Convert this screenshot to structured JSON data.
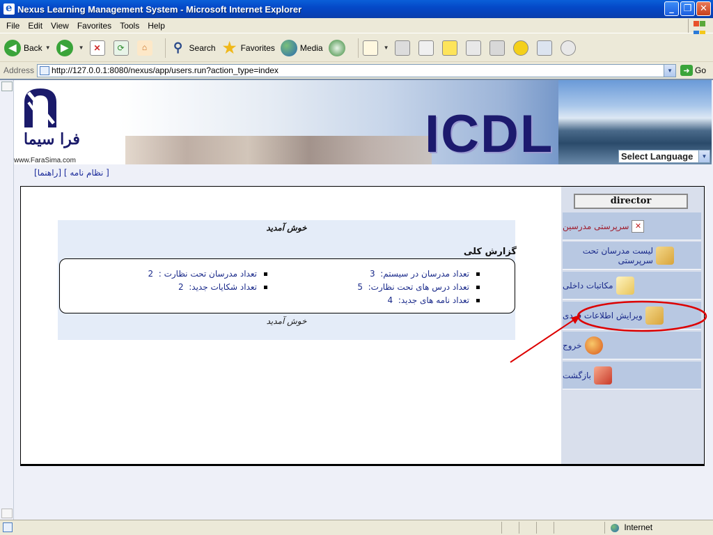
{
  "window": {
    "title": "Nexus Learning Management System - Microsoft Internet Explorer",
    "buttons": [
      "_",
      "❐",
      "✕"
    ]
  },
  "menubar": [
    "File",
    "Edit",
    "View",
    "Favorites",
    "Tools",
    "Help"
  ],
  "toolbar": {
    "back": "Back",
    "search": "Search",
    "favorites": "Favorites",
    "media": "Media"
  },
  "addressbar": {
    "label": "Address",
    "url": "http://127.0.0.1:8080/nexus/app/users.run?action_type=index",
    "go": "Go"
  },
  "banner": {
    "logo_text": "فرا سیما",
    "logo_url": "www.FaraSima.com",
    "brand": "ICDL",
    "language_select": "Select Language"
  },
  "toplinks": "[راهنما] [ نظام نامه ]",
  "sidebar": {
    "username": "director",
    "items": [
      {
        "label": "سرپرستی مدرسین",
        "icon": "close-box-icon"
      },
      {
        "label": "لیست مدرسان تحت سرپرستی",
        "icon": "magnifier-folder-icon"
      },
      {
        "label": "مکاتبات داخلی",
        "icon": "envelope-icon"
      },
      {
        "label": "ویرایش اطلاعات فردی",
        "icon": "magnifier-folder-icon"
      },
      {
        "label": "خروج",
        "icon": "exit-globe-icon"
      },
      {
        "label": "بازگشت",
        "icon": "home-icon"
      }
    ]
  },
  "main": {
    "welcome_title": "خوش آمدید",
    "report_title": "گزارش کلی",
    "stats": [
      {
        "label": "تعداد مدرسان در سیستم:",
        "value": "3"
      },
      {
        "label": "تعداد مدرسان تحت نظارت :",
        "value": "2"
      },
      {
        "label": "تعداد درس های تحت نظارت:",
        "value": "5"
      },
      {
        "label": "تعداد شکایات جدید:",
        "value": "2"
      },
      {
        "label": "تعداد نامه های جدید:",
        "value": "4"
      }
    ],
    "welcome_footer": "خوش آمدید"
  },
  "statusbar": {
    "zone": "Internet"
  },
  "colors": {
    "annotation": "#dd0000",
    "sidebar_bg": "#d9dfec",
    "menu_item_bg": "#b8c8e2",
    "link_text": "#1a2a8a"
  }
}
